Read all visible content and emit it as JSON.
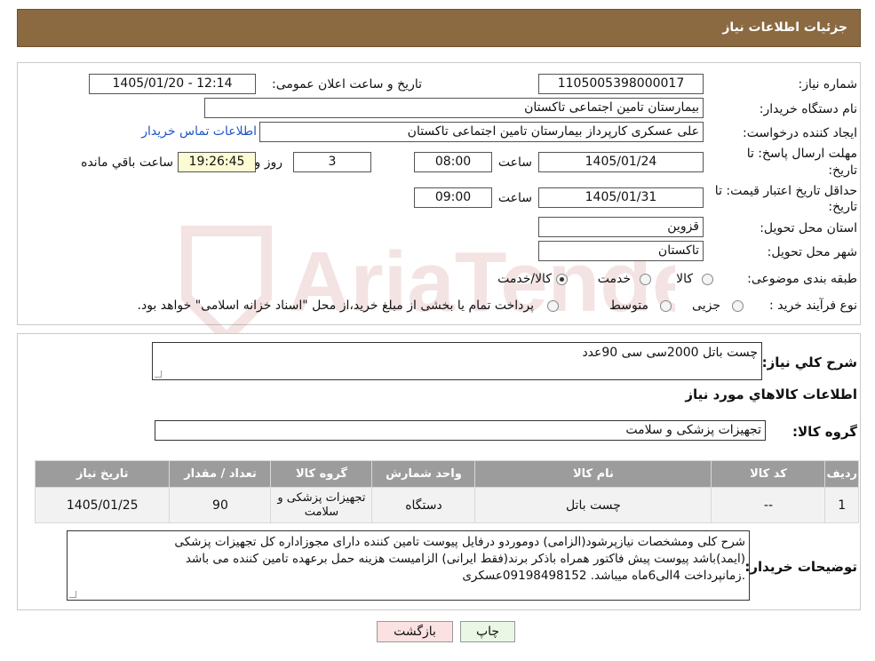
{
  "header": {
    "title": "جزئیات اطلاعات نیاز"
  },
  "form": {
    "need_number_label": "شماره نیاز:",
    "need_number": "1105005398000017",
    "announce_label": "تاریخ و ساعت اعلان عمومی:",
    "announce_value": "1405/01/20 - 12:14",
    "buyer_org_label": "نام دستگاه خریدار:",
    "buyer_org": "بیمارستان تامین اجتماعی تاکستان",
    "creator_label": "ایجاد کننده درخواست:",
    "creator": "علی عسکری کارپرداز بیمارستان تامین اجتماعی تاکستان",
    "contact_link": "اطلاعات تماس خریدار",
    "deadline_label_1": "مهلت ارسال پاسخ: تا",
    "deadline_label_2": "تاریخ:",
    "deadline_date": "1405/01/24",
    "time_label": "ساعت",
    "deadline_time": "08:00",
    "days_value": "3",
    "days_label": "روز و",
    "remaining_time": "19:26:45",
    "remaining_label": "ساعت باقي مانده",
    "validity_label_1": "حداقل تاریخ اعتبار قیمت: تا",
    "validity_label_2": "تاریخ:",
    "validity_date": "1405/01/31",
    "validity_time": "09:00",
    "province_label": "استان محل تحویل:",
    "province": "قزوین",
    "city_label": "شهر محل تحویل:",
    "city": "تاکستان",
    "category_label": "طبقه بندی موضوعی:",
    "category_options": [
      "کالا",
      "خدمت",
      "کالا/خدمت"
    ],
    "category_selected": "کالا/خدمت",
    "process_label": "نوع فرآیند خرید :",
    "process_options": [
      "جزیی",
      "متوسط"
    ],
    "process_note": "پرداخت تمام یا بخشی از مبلغ خرید،از محل \"اسناد خزانه اسلامی\" خواهد بود."
  },
  "summary": {
    "label": "شرح کلي نياز:",
    "value": "چست باتل 2000سی سی 90عدد",
    "goods_info_title": "اطلاعات کالاهاي مورد نياز",
    "group_label": "گروه کالا:",
    "group_value": "تجهیزات پزشکی و سلامت"
  },
  "table": {
    "headers": [
      "رديف",
      "کد کالا",
      "نام کالا",
      "واحد شمارش",
      "گروه کالا",
      "تعداد / مقدار",
      "تاریخ نیاز"
    ],
    "rows": [
      {
        "row": "1",
        "code": "--",
        "name": "چست باتل",
        "unit": "دستگاه",
        "group": "تجهیزات پزشکی و سلامت",
        "qty": "90",
        "date": "1405/01/25"
      }
    ]
  },
  "notes": {
    "label": "توضیحات خریدار:",
    "line1": "شرح کلی ومشخصات نیازپرشود(الزامی) دوموردو درفایل پیوست تامین کننده دارای مجوزاداره کل تجهیزات پزشکی",
    "line2": "(ایمد)باشد پیوست پیش فاکتور همراه باذکر برند(فقط ایرانی) الزامیست هزینه حمل برعهده تامین کننده می باشد",
    "line3": ".زمانپرداخت 4الی6ماه میباشد. 09198498152عسکری"
  },
  "buttons": {
    "print": "چاپ",
    "back": "بازگشت"
  },
  "colors": {
    "header_bg": "#8b6a42",
    "table_header_bg": "#9c9c9c",
    "print_bg": "#e9f7e4",
    "back_bg": "#fbe1e1"
  }
}
